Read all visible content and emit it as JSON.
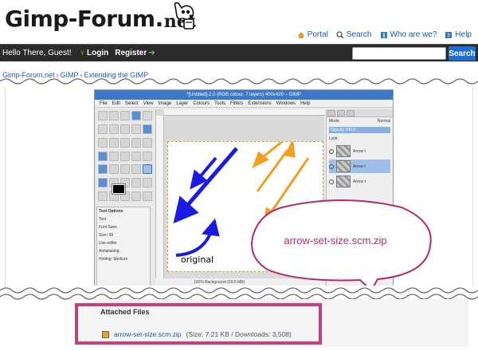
{
  "site": {
    "logo_main": "Gimp-Forum.",
    "logo_net": "net"
  },
  "toplinks": [
    {
      "label": "Portal",
      "icon": "portal-icon"
    },
    {
      "label": "Search",
      "icon": "search-icon"
    },
    {
      "label": "Who are we?",
      "icon": "info-icon"
    },
    {
      "label": "Help",
      "icon": "help-icon"
    }
  ],
  "navbar": {
    "greeting": "Hello There, Guest!",
    "login": "Login",
    "register": "Register",
    "search_button": "Search",
    "search_placeholder": ""
  },
  "breadcrumb": [
    "Gimp-Forum.net",
    "GIMP",
    "Extending the GIMP"
  ],
  "gimp": {
    "title": "*[Untitled]-2.0 (RGB colour, 7 layers) 400x420 – GIMP",
    "menu": [
      "File",
      "Edit",
      "Select",
      "View",
      "Image",
      "Layer",
      "Colours",
      "Tools",
      "Filters",
      "Extensions",
      "Windows",
      "Help"
    ],
    "tool_options_title": "Tool Options",
    "tool_options": {
      "text": "Text",
      "font_label": "Font",
      "font_value": "Sans",
      "size_label": "Size:",
      "size_value": "39",
      "use_editor": "Use editor",
      "antialiasing": "Antialiasing",
      "hinting_label": "Hinting:",
      "hinting_value": "Medium"
    },
    "layers": {
      "mode_label": "Mode:",
      "mode_value": "Normal",
      "opacity_label": "Opacity",
      "opacity_value": "100.0",
      "lock_label": "Lock:",
      "layer_names": [
        "Arrow t",
        "Arrow t",
        "Arrow t"
      ]
    },
    "status": "Background (59.5 MB)",
    "zoom": "100%",
    "canvas_text": "original"
  },
  "callout": {
    "text": "arrow-set-size.scm.zip"
  },
  "attachments": {
    "title": "Attached Files",
    "file_name": "arrow-set-size.scm.zip",
    "meta": "(Size: 7.21 KB / Downloads: 3,508)"
  },
  "colors": {
    "navbar": "#2b2b2b",
    "link": "#1e5aa8",
    "search_button": "#1e6fd0",
    "highlight_border": "#c2407c",
    "callout_text": "#b02c6c",
    "arrow_blue": "#1a1ae0",
    "arrow_orange": "#f0a020"
  }
}
